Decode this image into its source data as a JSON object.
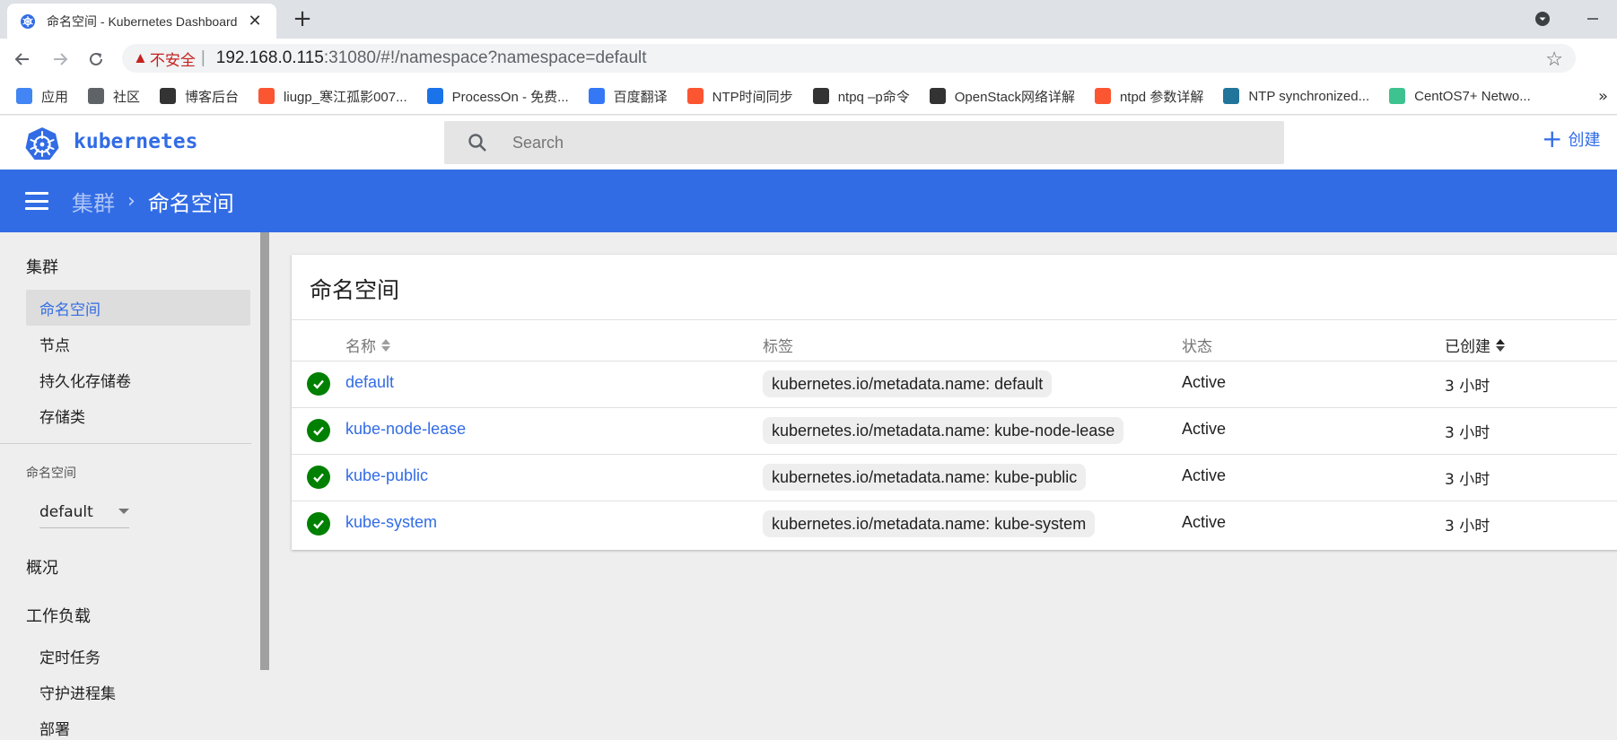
{
  "browser": {
    "tab_title": "命名空间 - Kubernetes Dashboard",
    "url_host": "192.168.0.115",
    "url_rest": ":31080/#!/namespace?namespace=default",
    "insecure_label": "不安全",
    "bookmarks": [
      {
        "label": "应用",
        "icon": "apps-grid-icon",
        "color": "#4285f4"
      },
      {
        "label": "社区",
        "icon": "globe-icon",
        "color": "#5f6368"
      },
      {
        "label": "博客后台",
        "icon": "cnblogs-icon",
        "color": "#333333"
      },
      {
        "label": "liugp_寒江孤影007...",
        "icon": "csdn-icon",
        "color": "#fc5531"
      },
      {
        "label": "ProcessOn - 免费...",
        "icon": "processon-icon",
        "color": "#1a73e8"
      },
      {
        "label": "百度翻译",
        "icon": "baidu-translate-icon",
        "color": "#3478f6"
      },
      {
        "label": "NTP时间同步",
        "icon": "csdn-icon",
        "color": "#fc5531"
      },
      {
        "label": "ntpq –p命令",
        "icon": "cnblogs-icon",
        "color": "#333333"
      },
      {
        "label": "OpenStack网络详解",
        "icon": "cnblogs-icon",
        "color": "#333333"
      },
      {
        "label": "ntpd 参数详解",
        "icon": "csdn-icon",
        "color": "#fc5531"
      },
      {
        "label": "NTP synchronized...",
        "icon": "wordpress-icon",
        "color": "#21759b"
      },
      {
        "label": "CentOS7+ Netwo...",
        "icon": "bookmark-green-icon",
        "color": "#3ec28f"
      }
    ]
  },
  "header": {
    "brand": "kubernetes",
    "search_placeholder": "Search",
    "create_label": "创建"
  },
  "breadcrumb": {
    "parent": "集群",
    "current": "命名空间"
  },
  "sidebar": {
    "cluster_title": "集群",
    "cluster_items": [
      "命名空间",
      "节点",
      "持久化存储卷",
      "存储类"
    ],
    "namespace_label": "命名空间",
    "namespace_value": "default",
    "overview": "概况",
    "workloads": "工作负载",
    "workload_items": [
      "定时任务",
      "守护进程集",
      "部署"
    ]
  },
  "main": {
    "card_title": "命名空间",
    "columns": {
      "name": "名称",
      "labels": "标签",
      "status": "状态",
      "created": "已创建"
    },
    "rows": [
      {
        "name": "default",
        "label": "kubernetes.io/metadata.name: default",
        "status": "Active",
        "created": "3 小时"
      },
      {
        "name": "kube-node-lease",
        "label": "kubernetes.io/metadata.name: kube-node-lease",
        "status": "Active",
        "created": "3 小时"
      },
      {
        "name": "kube-public",
        "label": "kubernetes.io/metadata.name: kube-public",
        "status": "Active",
        "created": "3 小时"
      },
      {
        "name": "kube-system",
        "label": "kubernetes.io/metadata.name: kube-system",
        "status": "Active",
        "created": "3 小时"
      }
    ]
  },
  "colors": {
    "accent": "#326ce5",
    "success": "#008000"
  }
}
